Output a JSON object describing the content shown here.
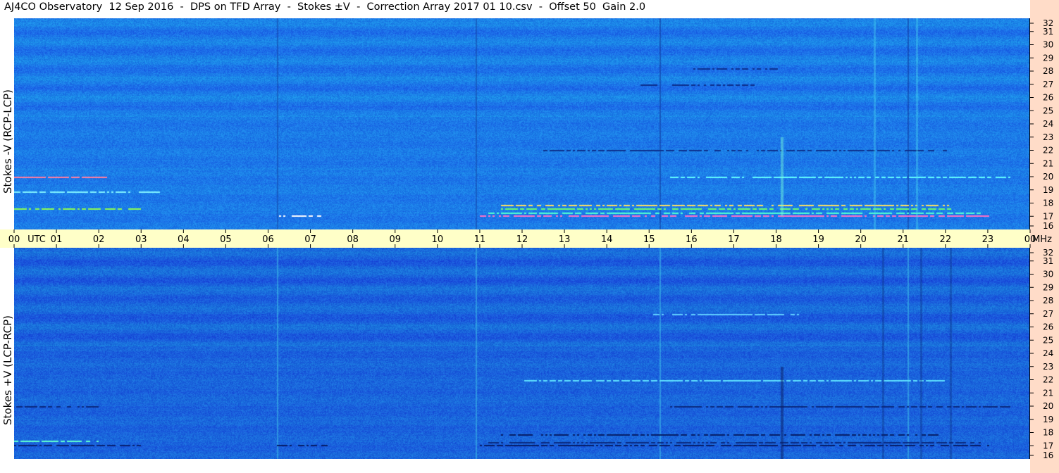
{
  "title": "AJ4CO Observatory  12 Sep 2016  -  DPS on TFD Array  -  Stokes ±V  -  Correction Array 2017 01 10.csv  -  Offset 50  Gain 2.0",
  "panels": {
    "top": {
      "ylabel": "Stokes -V (RCP-LCP)"
    },
    "bottom": {
      "ylabel": "Stokes +V (LCP-RCP)"
    }
  },
  "time_axis": {
    "labels": [
      "00",
      "UTC",
      "01",
      "02",
      "03",
      "04",
      "05",
      "06",
      "07",
      "08",
      "09",
      "10",
      "11",
      "12",
      "13",
      "14",
      "15",
      "16",
      "17",
      "18",
      "19",
      "20",
      "21",
      "22",
      "23",
      "00",
      "MHz"
    ]
  },
  "freq_axis": {
    "labels": [
      "32",
      "31",
      "30",
      "29",
      "28",
      "27",
      "26",
      "25",
      "24",
      "23",
      "22",
      "21",
      "20",
      "19",
      "18",
      "17",
      "16"
    ]
  },
  "colors": {
    "background_blue": "#1f7ae8",
    "axis_strip": "#ffffc8",
    "right_strip": "#ffdcc8"
  },
  "chart_data": [
    {
      "type": "heatmap",
      "title": "Stokes -V (RCP-LCP)",
      "x_range_utc_hours": [
        0,
        24
      ],
      "y_range_mhz": [
        16,
        32
      ],
      "y_ticks": [
        16,
        17,
        18,
        19,
        20,
        21,
        22,
        23,
        24,
        25,
        26,
        27,
        28,
        29,
        30,
        31,
        32
      ],
      "x_ticks": [
        "00",
        "01",
        "02",
        "03",
        "04",
        "05",
        "06",
        "07",
        "08",
        "09",
        "10",
        "11",
        "12",
        "13",
        "14",
        "15",
        "16",
        "17",
        "18",
        "19",
        "20",
        "21",
        "22",
        "23",
        "00"
      ]
    },
    {
      "type": "heatmap",
      "title": "Stokes +V (LCP-RCP)",
      "x_range_utc_hours": [
        0,
        24
      ],
      "y_range_mhz": [
        16,
        32
      ],
      "y_ticks": [
        16,
        17,
        18,
        19,
        20,
        21,
        22,
        23,
        24,
        25,
        26,
        27,
        28,
        29,
        30,
        31,
        32
      ],
      "x_ticks": [
        "00",
        "01",
        "02",
        "03",
        "04",
        "05",
        "06",
        "07",
        "08",
        "09",
        "10",
        "11",
        "12",
        "13",
        "14",
        "15",
        "16",
        "17",
        "18",
        "19",
        "20",
        "21",
        "22",
        "23",
        "00"
      ]
    }
  ]
}
